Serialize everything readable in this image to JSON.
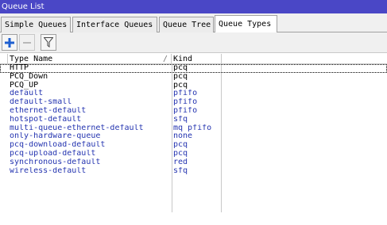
{
  "window": {
    "title": "Queue List"
  },
  "tabs": [
    {
      "label": "Simple Queues",
      "active": false
    },
    {
      "label": "Interface Queues",
      "active": false
    },
    {
      "label": "Queue Tree",
      "active": false
    },
    {
      "label": "Queue Types",
      "active": true
    }
  ],
  "toolbar": {
    "add_icon": "plus-icon",
    "remove_icon": "minus-icon",
    "filter_icon": "filter-icon",
    "add_color": "#1e5fd0"
  },
  "table": {
    "columns": [
      {
        "label": "Type Name"
      },
      {
        "label": "Kind"
      }
    ],
    "rows": [
      {
        "name": "HTTP",
        "kind": "pcq",
        "dynamic": false
      },
      {
        "name": "PCQ_Down",
        "kind": "pcq",
        "dynamic": false
      },
      {
        "name": "PCQ_UP",
        "kind": "pcq",
        "dynamic": false
      },
      {
        "name": "default",
        "kind": "pfifo",
        "dynamic": true
      },
      {
        "name": "default-small",
        "kind": "pfifo",
        "dynamic": true
      },
      {
        "name": "ethernet-default",
        "kind": "pfifo",
        "dynamic": true
      },
      {
        "name": "hotspot-default",
        "kind": "sfq",
        "dynamic": true
      },
      {
        "name": "multi-queue-ethernet-default",
        "kind": "mq pfifo",
        "dynamic": true
      },
      {
        "name": "only-hardware-queue",
        "kind": "none",
        "dynamic": true
      },
      {
        "name": "pcq-download-default",
        "kind": "pcq",
        "dynamic": true
      },
      {
        "name": "pcq-upload-default",
        "kind": "pcq",
        "dynamic": true
      },
      {
        "name": "synchronous-default",
        "kind": "red",
        "dynamic": true
      },
      {
        "name": "wireless-default",
        "kind": "sfq",
        "dynamic": true
      }
    ]
  },
  "colors": {
    "titlebar": "#4a47c6",
    "dynamic_text": "#2434b0"
  }
}
